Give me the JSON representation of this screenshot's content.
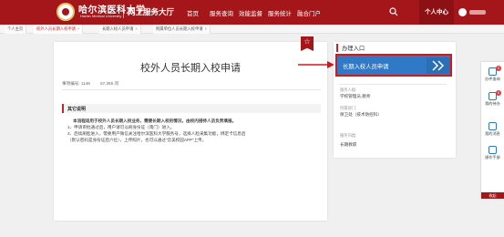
{
  "header": {
    "brand_cn": "哈尔滨医科大学",
    "brand_en": "Harbin Medical University",
    "portal_title": "网上服务大厅",
    "nav": [
      "首页",
      "服务查询",
      "效能监督",
      "服务统计",
      "融合门户"
    ],
    "user_center": "个人中心"
  },
  "tabs": [
    {
      "label": "个人主页",
      "active": false
    },
    {
      "label": "校外人员长期入校申请",
      "active": true
    },
    {
      "label": "长期入校人员申请",
      "active": false
    },
    {
      "label": "附属单位人员长期入校申请",
      "active": false
    }
  ],
  "main": {
    "title": "校外人员长期入校申请",
    "meta_id_label": "事项编号:",
    "meta_id": "1148",
    "meta_views": "57,355",
    "meta_views_unit": "问",
    "section_title": "其它说明",
    "desc_lines": [
      "本流程适用于校外人员长期入校业务，需要长期入校的情况，由校内接待人员负责填报。",
      "1、申请审批通过后，用户请可以刷身份证（南门）进入。",
      "2、后续刷脸进入，需要用户微信关注哈尔滨医科大学服务号，选择人脸采集功能，绑定卡信息后",
      "（默认密码是身份证后六位），上传照片，也可以通过“云美校园APP”上传。"
    ]
  },
  "side": {
    "title": "办理入口",
    "apply_label": "长期入校人员申请",
    "served_label": "服务人群:",
    "served_value": "学校管理员,教师",
    "dept_label": "所属部门:",
    "dept_value": "保卫处（技术防控科）",
    "category_label": "服务归类:",
    "category_value": "长期教职"
  },
  "toolbar": [
    {
      "label": "办件查询",
      "badge": "0",
      "icon": "search-doc-icon"
    },
    {
      "label": "我的待办",
      "badge": "0",
      "icon": "todo-icon"
    },
    {
      "label": "我的消息",
      "badge": "",
      "icon": "message-icon"
    },
    {
      "label": "操作手册",
      "badge": "",
      "icon": "manual-icon"
    }
  ],
  "toolbar_collapse": "收起",
  "colors": {
    "brand_red": "#a5161a",
    "apply_blue": "#2f79c6",
    "highlight_red": "#d4171d"
  }
}
